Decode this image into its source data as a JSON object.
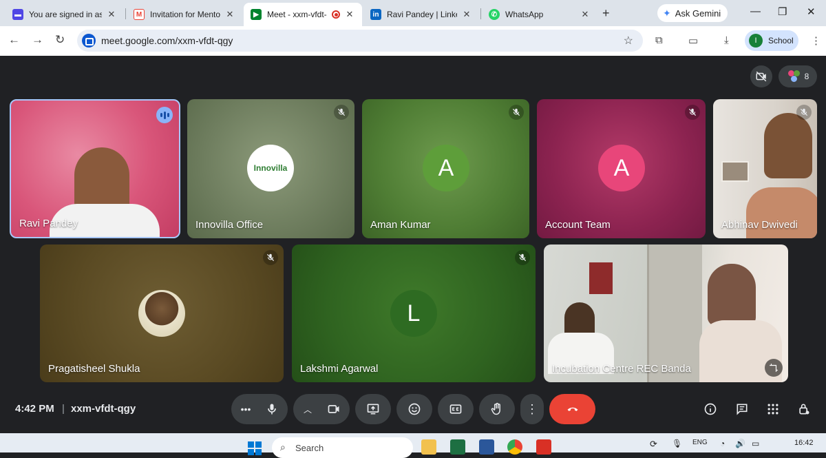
{
  "browser": {
    "tabs": [
      {
        "title": "You are signed in as i",
        "fav_color": "#4f46e5",
        "fav_glyph": "▬"
      },
      {
        "title": "Invitation for Mentor",
        "fav_color": "#ea4335",
        "fav_glyph": "M"
      },
      {
        "title": "Meet - xxm-vfdt-",
        "fav_color": "#00832d",
        "fav_glyph": "▶"
      },
      {
        "title": "Ravi Pandey | Linkedi",
        "fav_color": "#0a66c2",
        "fav_glyph": "in"
      },
      {
        "title": "WhatsApp",
        "fav_color": "#25d366",
        "fav_glyph": "✆"
      }
    ],
    "new_tab_glyph": "+",
    "ask_gemini": "Ask Gemini",
    "url": "meet.google.com/xxm-vfdt-qgy",
    "profile_initial": "I",
    "profile_label": "School"
  },
  "meet": {
    "participant_count": "8",
    "participants": [
      {
        "name": "Ravi Pandey",
        "kind": "video",
        "speaking": true
      },
      {
        "name": "Innovilla Office",
        "kind": "logo",
        "logo_text": "Innovilla",
        "muted": true
      },
      {
        "name": "Aman Kumar",
        "kind": "avatar",
        "initial": "A",
        "avatar_color": "#5e9e3a",
        "muted": true
      },
      {
        "name": "Account Team",
        "kind": "avatar",
        "initial": "A",
        "avatar_color": "#e8467a",
        "muted": true
      },
      {
        "name": "Abhinav Dwivedi",
        "kind": "video",
        "muted": true
      },
      {
        "name": "Pragatisheel Shukla",
        "kind": "photo",
        "muted": true
      },
      {
        "name": "Lakshmi Agarwal",
        "kind": "avatar",
        "initial": "L",
        "avatar_color": "#3f7a2a",
        "muted": true
      },
      {
        "name": "Incubation Centre REC Banda",
        "kind": "video"
      }
    ],
    "time": "4:42 PM",
    "meeting_code": "xxm-vfdt-qgy"
  },
  "taskbar": {
    "search_placeholder": "Search",
    "lang": "ENG",
    "clock": "16:42"
  },
  "colors": {
    "stage_bg": "#202124",
    "control_bg": "#3c4043",
    "end_call": "#ea4335",
    "speaking": "#8ab4f8"
  }
}
